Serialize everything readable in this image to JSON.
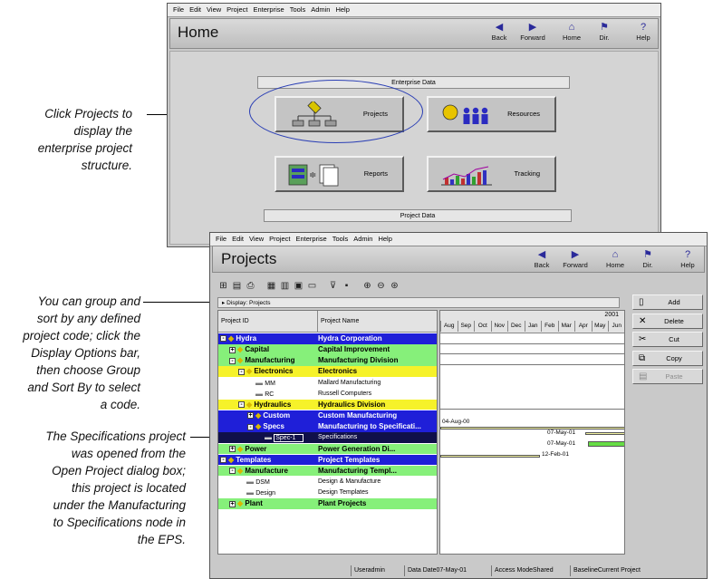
{
  "callouts": {
    "projects": [
      "Click Projects to",
      "display the",
      "enterprise project",
      "structure."
    ],
    "group": [
      "You can group and",
      "sort by any defined",
      "project code; click the",
      "Display Options bar,",
      "then choose Group",
      "and Sort By to select",
      "a code."
    ],
    "spec": [
      "The Specifications project",
      "was opened from the",
      "Open Project dialog box;",
      "this project is located",
      "under the Manufacturing",
      "to Specifications node in",
      "the EPS."
    ]
  },
  "home_window": {
    "menu": [
      "File",
      "Edit",
      "View",
      "Project",
      "Enterprise",
      "Tools",
      "Admin",
      "Help"
    ],
    "title": "Home",
    "nav": [
      {
        "label": "Back",
        "icon": "back-arrow-icon"
      },
      {
        "label": "Forward",
        "icon": "forward-arrow-icon"
      },
      {
        "label": "Home",
        "icon": "home-icon"
      },
      {
        "label": "Dir.",
        "icon": "directory-icon"
      },
      {
        "label": "Help",
        "icon": "help-icon"
      }
    ],
    "enterprise_section": "Enterprise Data",
    "tiles": {
      "projects": "Projects",
      "resources": "Resources",
      "reports": "Reports",
      "tracking": "Tracking"
    },
    "project_section": "Project Data"
  },
  "projects_window": {
    "menu": [
      "File",
      "Edit",
      "View",
      "Project",
      "Enterprise",
      "Tools",
      "Admin",
      "Help"
    ],
    "title": "Projects",
    "nav": [
      {
        "label": "Back",
        "icon": "back-arrow-icon"
      },
      {
        "label": "Forward",
        "icon": "forward-arrow-icon"
      },
      {
        "label": "Home",
        "icon": "home-icon"
      },
      {
        "label": "Dir.",
        "icon": "directory-icon"
      },
      {
        "label": "Help",
        "icon": "help-icon"
      }
    ],
    "display_bar": "Display: Projects",
    "columns": {
      "id": "Project ID",
      "name": "Project Name"
    },
    "gantt": {
      "year": "2001",
      "months": [
        "Aug",
        "Sep",
        "Oct",
        "Nov",
        "Dec",
        "Jan",
        "Feb",
        "Mar",
        "Apr",
        "May",
        "Jun",
        "Ju"
      ],
      "labels": {
        "a": "04-Aug-00",
        "b": "07-May-01",
        "c": "07-May-01",
        "d": "12-Feb-01"
      }
    },
    "rows": [
      {
        "id": "Hydra",
        "name": "Hydra Corporation",
        "type": "eps",
        "level": 0,
        "bg": "#1f1fd8",
        "fg": "#ffffff",
        "toggle": "-"
      },
      {
        "id": "Capital",
        "name": "Capital Improvement",
        "type": "eps",
        "level": 1,
        "bg": "#86f07a",
        "fg": "#000000",
        "toggle": "+"
      },
      {
        "id": "Manufacturing",
        "name": "Manufacturing Division",
        "type": "eps",
        "level": 1,
        "bg": "#86f07a",
        "fg": "#000000",
        "toggle": "-"
      },
      {
        "id": "Electronics",
        "name": "Electronics",
        "type": "eps",
        "level": 2,
        "bg": "#f6f22a",
        "fg": "#000000",
        "toggle": "-"
      },
      {
        "id": "MM",
        "name": "Mallard Manufacturing",
        "type": "project",
        "level": 3,
        "bg": "#ffffff",
        "fg": "#000000",
        "toggle": ""
      },
      {
        "id": "RC",
        "name": "Russell Computers",
        "type": "project",
        "level": 3,
        "bg": "#ffffff",
        "fg": "#000000",
        "toggle": ""
      },
      {
        "id": "Hydraulics",
        "name": "Hydraulics Division",
        "type": "eps",
        "level": 2,
        "bg": "#f6f22a",
        "fg": "#000000",
        "toggle": "-"
      },
      {
        "id": "Custom",
        "name": "Custom Manufacturing",
        "type": "eps",
        "level": 3,
        "bg": "#1f1fd8",
        "fg": "#ffffff",
        "toggle": "+"
      },
      {
        "id": "Specs",
        "name": "Manufacturing to Specificati...",
        "type": "eps",
        "level": 3,
        "bg": "#1f1fd8",
        "fg": "#ffffff",
        "toggle": "-"
      },
      {
        "id": "Spec-1",
        "name": "Specifications",
        "type": "project",
        "level": 4,
        "bg": "#10104a",
        "fg": "#ffffff",
        "toggle": ""
      },
      {
        "id": "Power",
        "name": "Power Generation Di...",
        "type": "eps",
        "level": 1,
        "bg": "#86f07a",
        "fg": "#000000",
        "toggle": "+"
      },
      {
        "id": "Templates",
        "name": "Project Templates",
        "type": "eps",
        "level": 0,
        "bg": "#1f1fd8",
        "fg": "#ffffff",
        "toggle": "-"
      },
      {
        "id": "Manufacture",
        "name": "Manufacturing Templ...",
        "type": "eps",
        "level": 1,
        "bg": "#86f07a",
        "fg": "#000000",
        "toggle": "-"
      },
      {
        "id": "DSM",
        "name": "Design & Manufacture",
        "type": "project",
        "level": 2,
        "bg": "#ffffff",
        "fg": "#000000",
        "toggle": ""
      },
      {
        "id": "Design",
        "name": "Design Templates",
        "type": "project",
        "level": 2,
        "bg": "#ffffff",
        "fg": "#000000",
        "toggle": ""
      },
      {
        "id": "Plant",
        "name": "Plant Projects",
        "type": "eps",
        "level": 1,
        "bg": "#86f07a",
        "fg": "#000000",
        "toggle": "+"
      }
    ],
    "side_buttons": [
      {
        "label": "Add",
        "icon": "add-icon",
        "enabled": true
      },
      {
        "label": "Delete",
        "icon": "delete-icon",
        "enabled": true
      },
      {
        "label": "Cut",
        "icon": "cut-icon",
        "enabled": true
      },
      {
        "label": "Copy",
        "icon": "copy-icon",
        "enabled": true
      },
      {
        "label": "Paste",
        "icon": "paste-icon",
        "enabled": false
      }
    ],
    "status": {
      "user": "Useradmin",
      "date": "Data Date07-May-01",
      "access": "Access ModeShared",
      "baseline": "BaselineCurrent Project"
    }
  }
}
